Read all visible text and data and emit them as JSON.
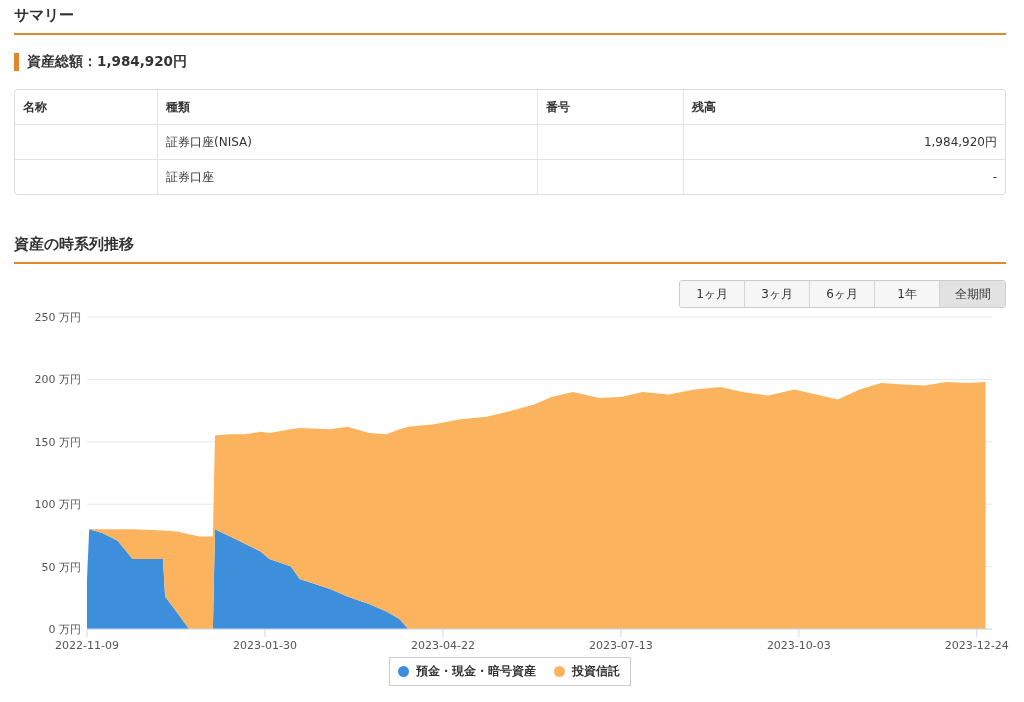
{
  "summary": {
    "title": "サマリー",
    "total": "資産総額：1,984,920円",
    "table": {
      "columns": [
        "名称",
        "種類",
        "番号",
        "残高"
      ],
      "rows": [
        {
          "type": "証券口座(NISA)",
          "balance": "1,984,920円"
        },
        {
          "type": "証券口座",
          "balance": "-"
        }
      ]
    }
  },
  "history": {
    "title": "資産の時系列推移",
    "ranges": [
      {
        "label": "1ヶ月",
        "selected": false
      },
      {
        "label": "3ヶ月",
        "selected": false
      },
      {
        "label": "6ヶ月",
        "selected": false
      },
      {
        "label": "1年",
        "selected": false
      },
      {
        "label": "全期間",
        "selected": true
      }
    ],
    "chart_data": {
      "type": "area",
      "stacked": true,
      "x": [
        "2022-11-09",
        "2022-11-10",
        "2022-11-16",
        "2022-11-23",
        "2022-11-30",
        "2022-12-14",
        "2022-12-15",
        "2022-12-21",
        "2022-12-26",
        "2022-12-31",
        "2023-01-06",
        "2023-01-07",
        "2023-01-14",
        "2023-01-21",
        "2023-01-28",
        "2023-02-01",
        "2023-02-11",
        "2023-02-15",
        "2023-03-01",
        "2023-03-09",
        "2023-03-19",
        "2023-03-27",
        "2023-04-02",
        "2023-04-06",
        "2023-04-18",
        "2023-04-30",
        "2023-05-12",
        "2023-05-24",
        "2023-06-03",
        "2023-06-11",
        "2023-06-21",
        "2023-07-03",
        "2023-07-13",
        "2023-07-23",
        "2023-08-04",
        "2023-08-16",
        "2023-08-28",
        "2023-09-07",
        "2023-09-19",
        "2023-10-01",
        "2023-10-11",
        "2023-10-21",
        "2023-10-31",
        "2023-11-10",
        "2023-11-20",
        "2023-11-30",
        "2023-12-10",
        "2023-12-20",
        "2023-12-28"
      ],
      "series": [
        {
          "name": "預金・現金・暗号資産",
          "color": "#3d8fdb",
          "values": [
            40,
            80,
            77,
            71,
            56,
            56,
            26,
            12,
            0,
            0,
            0,
            80,
            74,
            68,
            62,
            56,
            50,
            40,
            32,
            26,
            20,
            14,
            8,
            0,
            0,
            0,
            0,
            0,
            0,
            0,
            0,
            0,
            0,
            0,
            0,
            0,
            0,
            0,
            0,
            0,
            0,
            0,
            0,
            0,
            0,
            0,
            0,
            0,
            0
          ]
        },
        {
          "name": "投資信託",
          "color": "#fbb35e",
          "values": [
            0,
            0,
            3,
            9,
            24,
            23,
            53,
            66,
            76,
            74,
            74,
            75,
            82,
            88,
            96,
            101,
            110,
            121,
            128,
            136,
            137,
            142,
            152,
            162,
            164,
            168,
            170,
            175,
            180,
            186,
            190,
            185,
            186,
            190,
            188,
            192,
            194,
            190,
            187,
            192,
            188,
            184,
            192,
            197,
            196,
            195,
            198,
            197,
            198
          ]
        }
      ],
      "grid": true,
      "ylim": [
        0,
        250
      ],
      "yticks": [
        {
          "value": 0,
          "label": "0 万円"
        },
        {
          "value": 50,
          "label": "50 万円"
        },
        {
          "value": 100,
          "label": "100 万円"
        },
        {
          "value": 150,
          "label": "150 万円"
        },
        {
          "value": 200,
          "label": "200 万円"
        },
        {
          "value": 250,
          "label": "250 万円"
        }
      ],
      "xlim": [
        "2022-11-09",
        "2023-12-31"
      ],
      "xticks": [
        "2022-11-09",
        "2023-01-30",
        "2023-04-22",
        "2023-07-13",
        "2023-10-03",
        "2023-12-24"
      ]
    }
  }
}
